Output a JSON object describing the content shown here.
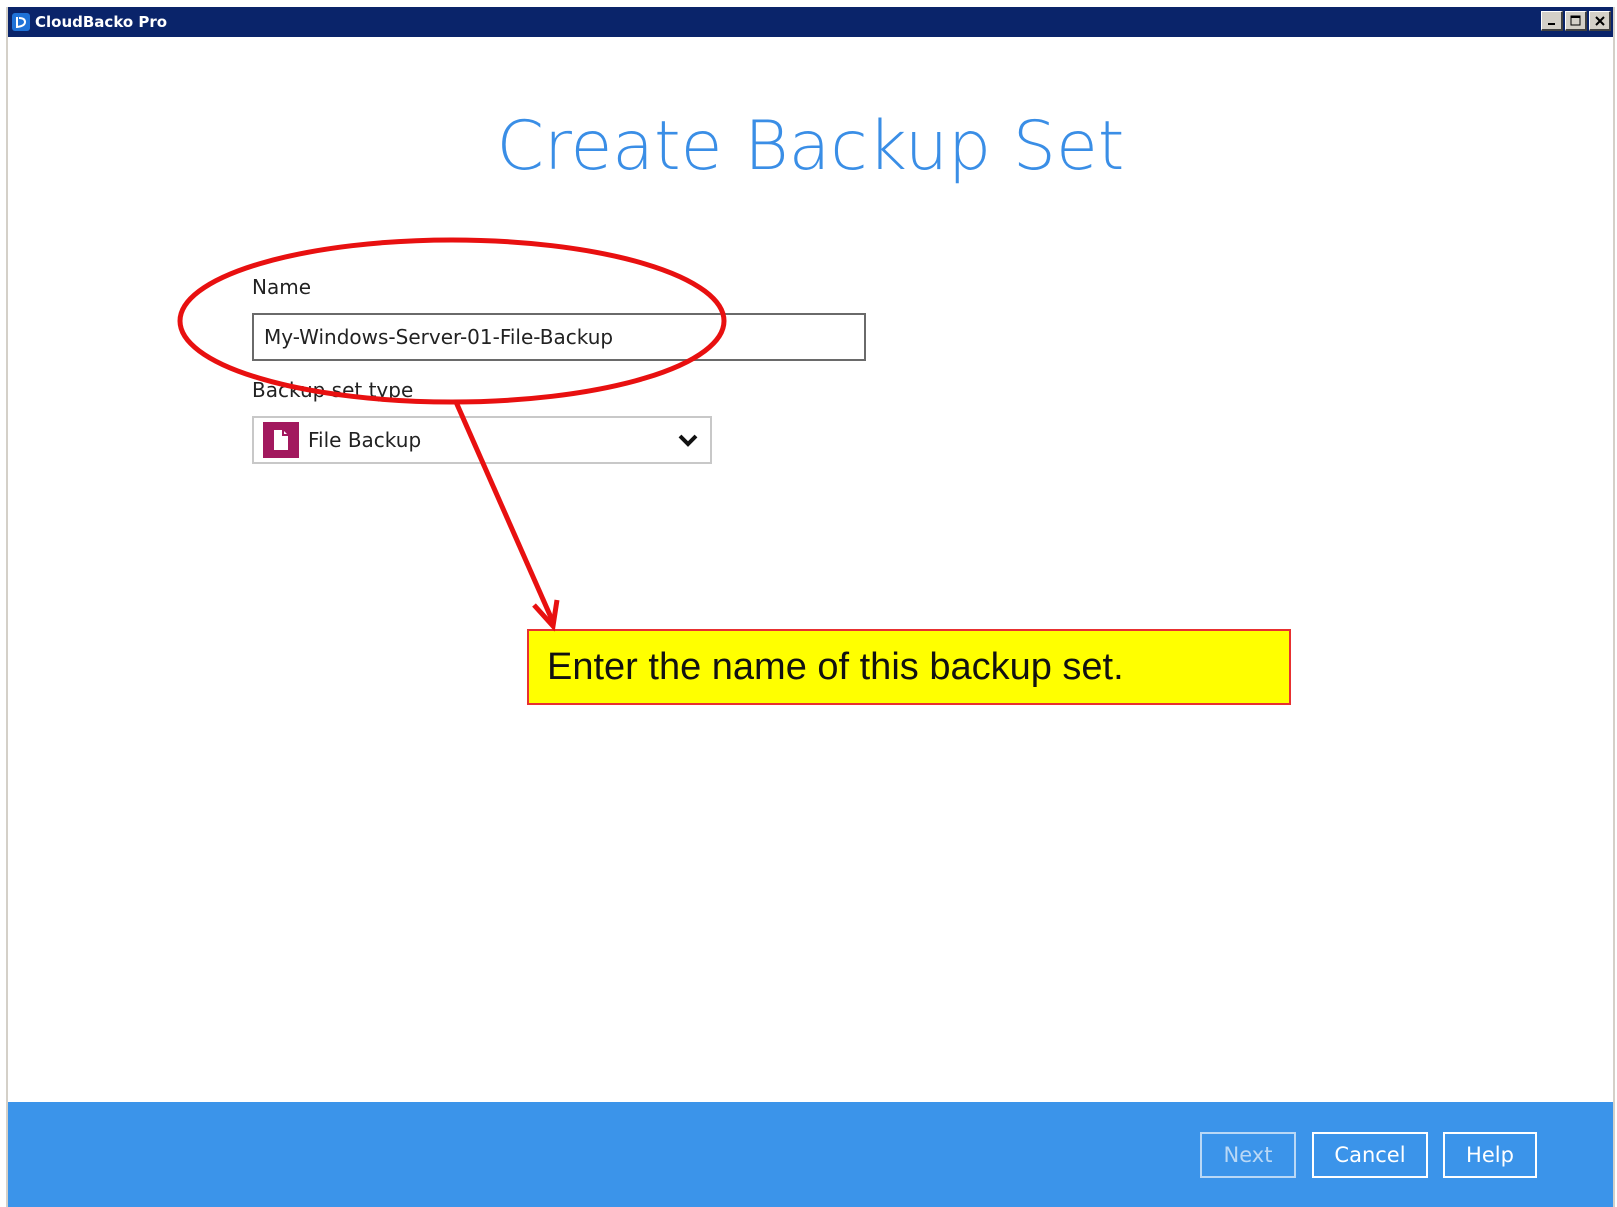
{
  "window": {
    "title": "CloudBacko Pro"
  },
  "page": {
    "title": "Create Backup Set"
  },
  "form": {
    "name_label": "Name",
    "name_value": "My-Windows-Server-01-File-Backup",
    "type_label": "Backup set type",
    "type_value": "File Backup"
  },
  "callout": {
    "text": "Enter the name of this backup set."
  },
  "footer": {
    "next_label": "Next",
    "next_enabled": false,
    "cancel_label": "Cancel",
    "help_label": "Help"
  },
  "colors": {
    "accent": "#3a8ee6",
    "footer_bg": "#3b94ea",
    "titlebar": "#0a246a",
    "file_icon_bg": "#a2195e",
    "callout_bg": "#ffff00",
    "annotation": "#e81010"
  },
  "icons": {
    "app": "cloudbacko-logo-icon",
    "type": "file-icon",
    "dropdown": "chevron-down-icon"
  }
}
